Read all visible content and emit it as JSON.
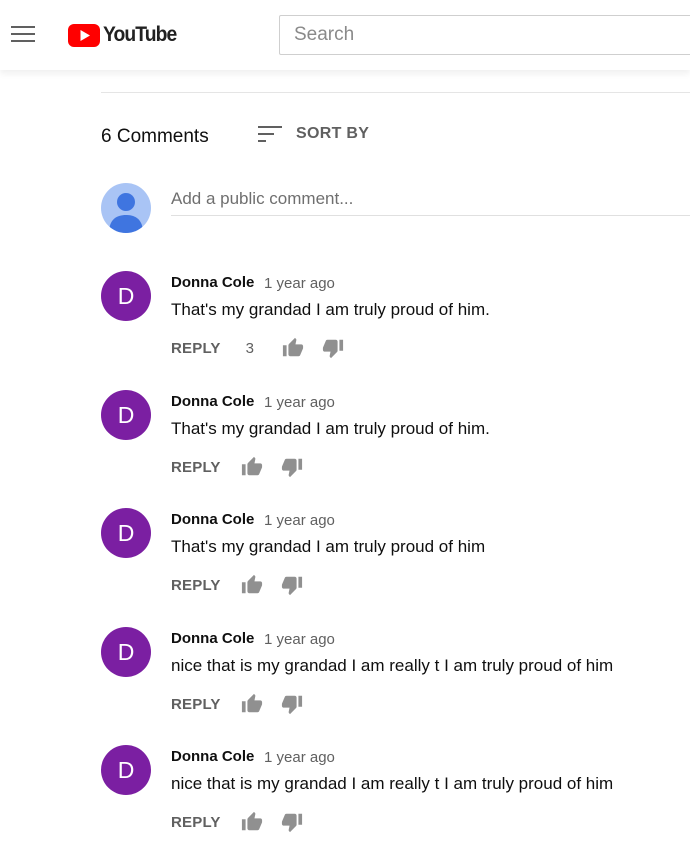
{
  "header": {
    "logo_text": "YouTube",
    "brand_color": "#ff0000",
    "search_placeholder": "Search"
  },
  "comments_section": {
    "count_label": "6 Comments",
    "sort_label": "SORT BY",
    "add_comment_placeholder": "Add a public comment...",
    "reply_label": "REPLY",
    "avatar_color": "#7b1fa2",
    "items": [
      {
        "avatar_letter": "D",
        "author": "Donna Cole",
        "time": "1 year ago",
        "text": "That's my grandad I am truly proud of him.",
        "likes": "3"
      },
      {
        "avatar_letter": "D",
        "author": "Donna Cole",
        "time": "1 year ago",
        "text": "That's my grandad I am truly proud of him.",
        "likes": ""
      },
      {
        "avatar_letter": "D",
        "author": "Donna Cole",
        "time": "1 year ago",
        "text": "That's my grandad I am truly proud of him",
        "likes": ""
      },
      {
        "avatar_letter": "D",
        "author": "Donna Cole",
        "time": "1 year ago",
        "text": "nice that is my grandad I am really t I am truly proud of him",
        "likes": ""
      },
      {
        "avatar_letter": "D",
        "author": "Donna Cole",
        "time": "1 year ago",
        "text": "nice that is my grandad I am really t I am truly proud of him",
        "likes": ""
      }
    ]
  }
}
